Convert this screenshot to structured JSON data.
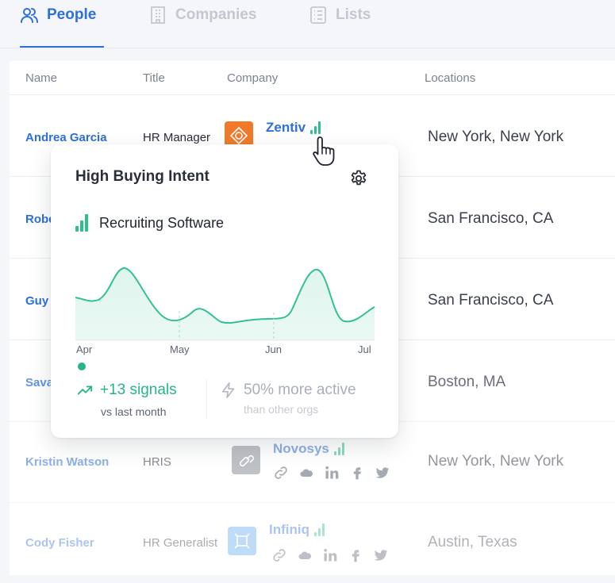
{
  "tabs": [
    {
      "label": "People",
      "icon": "people-icon",
      "active": true
    },
    {
      "label": "Companies",
      "icon": "building-icon",
      "active": false
    },
    {
      "label": "Lists",
      "icon": "list-icon",
      "active": false
    }
  ],
  "columns": [
    "Name",
    "Title",
    "Company",
    "Locations"
  ],
  "rows": [
    {
      "name": "Andrea Garcia",
      "title": "HR Manager",
      "company": "Zentiv",
      "location": "New York, New York"
    },
    {
      "name": "Robe",
      "title": "",
      "company": "",
      "location": "San Francisco, CA"
    },
    {
      "name": "Guy",
      "title": "",
      "company": "",
      "location": "San Francisco, CA"
    },
    {
      "name": "Sava",
      "title": "",
      "company": "",
      "location": "Boston, MA"
    },
    {
      "name": "Kristin Watson",
      "title": "HRIS",
      "company": "Novosys",
      "location": "New York, New York"
    },
    {
      "name": "Cody Fisher",
      "title": "HR Generalist",
      "company": "Infiniq",
      "location": "Austin, Texas"
    }
  ],
  "popup": {
    "title": "High Buying Intent",
    "topic": "Recruiting Software",
    "months": [
      "Apr",
      "May",
      "Jun",
      "Jul"
    ],
    "signals": "+13 signals",
    "signals_sub": "vs last month",
    "activity": "50% more active",
    "activity_sub": "than other orgs"
  },
  "colors": {
    "accent": "#2f6fdb",
    "intent": "#2fbf8a",
    "zentiv": "#f07a2a",
    "novosys": "#8a8f97",
    "infiniq": "#5ea8f2"
  }
}
